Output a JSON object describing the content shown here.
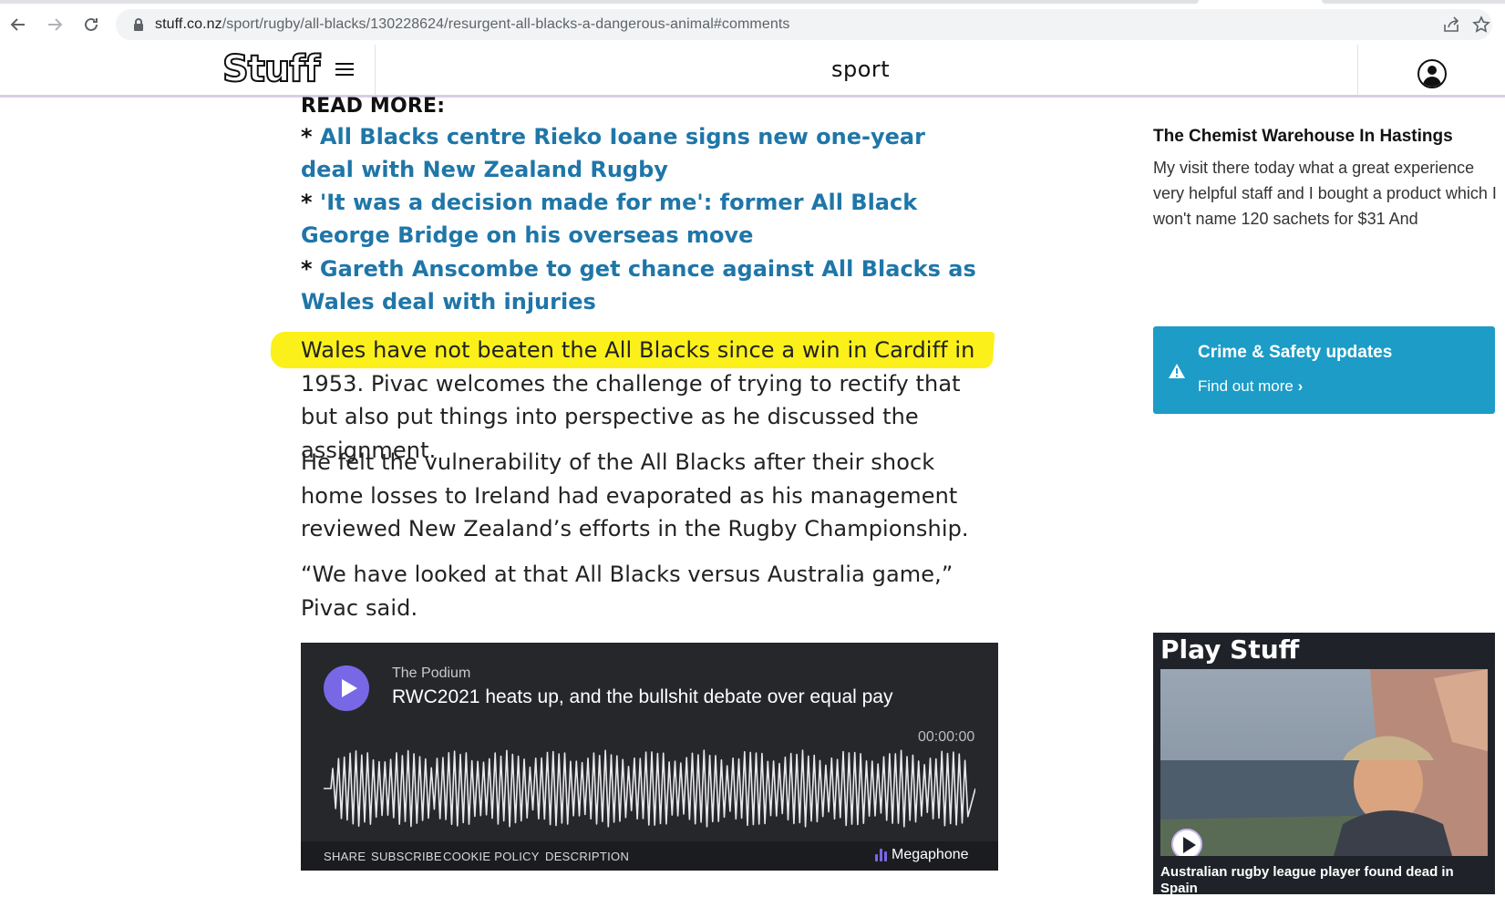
{
  "browser": {
    "url_domain": "stuff.co.nz",
    "url_path": "/sport/rugby/all-blacks/130228624/resurgent-all-blacks-a-dangerous-animal#comments"
  },
  "header": {
    "logo": "Stuff",
    "section": "sport"
  },
  "article": {
    "read_more_label": "READ MORE:",
    "read_more_links": [
      {
        "bullet": "* ",
        "text": "All Blacks centre Rieko Ioane signs new one-year deal with New Zealand Rugby"
      },
      {
        "bullet": "* ",
        "text": "'It was a decision made for me': former All Black George Bridge on his overseas move"
      },
      {
        "bullet": "* ",
        "text": "Gareth Anscombe to get chance against All Blacks as Wales deal with injuries"
      }
    ],
    "paragraphs": [
      "Wales have not beaten the All Blacks since a win in Cardiff in 1953. Pivac welcomes the challenge of trying to rectify that but also put things into perspective as he discussed the assignment.",
      "He felt the vulnerability of the All Blacks after their shock home losses to Ireland had evaporated as his management reviewed New Zealand’s efforts in the Rugby Championship.",
      "“We have looked at that All Blacks versus Australia game,” Pivac said."
    ],
    "highlight_color": "#fbf01a",
    "link_color": "#1f76a8"
  },
  "player": {
    "show": "The Podium",
    "title": "RWC2021 heats up, and the bullshit debate over equal pay",
    "time": "00:00:00",
    "footer_links": [
      "SHARE",
      "SUBSCRIBE",
      "COOKIE POLICY",
      "DESCRIPTION"
    ],
    "brand": "Megaphone",
    "accent": "#7868e6"
  },
  "aside": {
    "headline": "The Chemist Warehouse In Hastings",
    "body": "My visit there today what a great experience very helpful staff and I bought a product which I won't name 120 sachets for $31 And",
    "crime_title": "Crime & Safety updates",
    "crime_link": "Find out more",
    "crime_color": "#1c9cc7",
    "play_stuff_title": "Play Stuff",
    "play_stuff_caption": "Australian rugby league player found dead in Spain"
  }
}
